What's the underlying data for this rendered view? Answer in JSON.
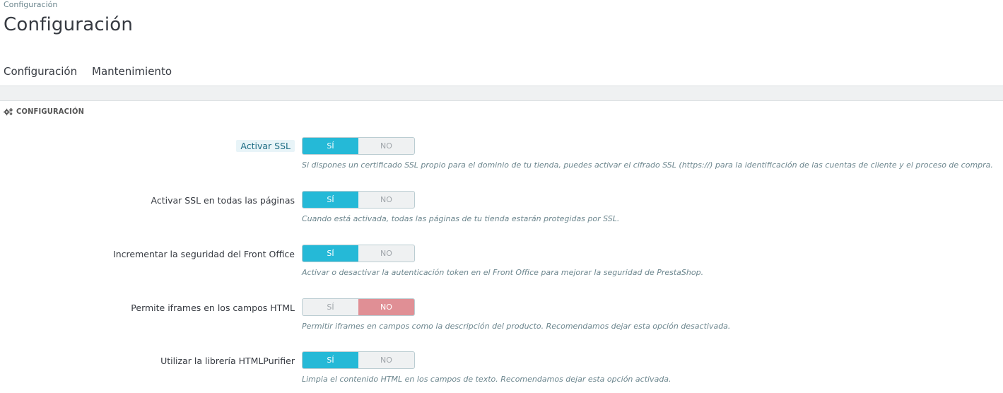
{
  "breadcrumb": "Configuración",
  "title": "Configuración",
  "tabs": [
    {
      "label": "Configuración",
      "active": true
    },
    {
      "label": "Mantenimiento",
      "active": false
    }
  ],
  "panel": {
    "heading": "CONFIGURACIÓN",
    "icon": "gears-icon"
  },
  "switch_labels": {
    "yes": "SÍ",
    "no": "NO"
  },
  "colors": {
    "accent": "#25b9d7",
    "danger": "#e08f95"
  },
  "fields": [
    {
      "label": "Activar SSL",
      "value": "yes",
      "help": "Si dispones un certificado SSL propio para el dominio de tu tienda, puedes activar el cifrado SSL (https://) para la identificación de las cuentas de cliente y el proceso de compra."
    },
    {
      "label": "Activar SSL en todas las páginas",
      "value": "yes",
      "help": "Cuando está activada, todas las páginas de tu tienda estarán protegidas por SSL."
    },
    {
      "label": "Incrementar la seguridad del Front Office",
      "value": "yes",
      "help": "Activar o desactivar la autenticación token en el Front Office para mejorar la seguridad de PrestaShop."
    },
    {
      "label": "Permite iframes en los campos HTML",
      "value": "no",
      "help": "Permitir iframes en campos como la descripción del producto. Recomendamos dejar esta opción desactivada."
    },
    {
      "label": "Utilizar la librería HTMLPurifier",
      "value": "yes",
      "help": "Limpia el contenido HTML en los campos de texto. Recomendamos dejar esta opción activada."
    }
  ]
}
